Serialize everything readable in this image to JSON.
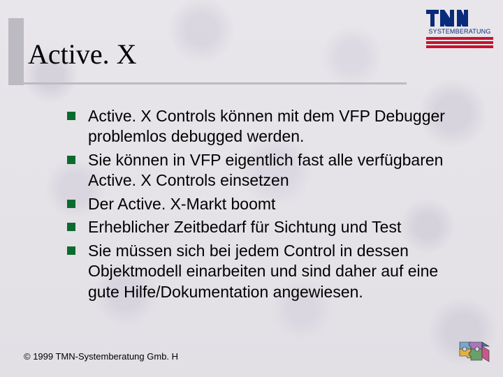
{
  "logo": {
    "subtext": "SYSTEMBERATUNG"
  },
  "title": "Active. X",
  "bullets": [
    "Active. X Controls können mit dem VFP Debugger problemlos debugged werden.",
    "Sie können in VFP eigentlich fast alle verfügbaren Active. X Controls einsetzen",
    "Der Active. X-Markt boomt",
    "Erheblicher Zeitbedarf für Sichtung und Test",
    "Sie müssen sich bei jedem Control in dessen Objektmodell einarbeiten und sind daher auf eine gute Hilfe/Dokumentation angewiesen."
  ],
  "footer": "© 1999 TMN-Systemberatung Gmb. H"
}
